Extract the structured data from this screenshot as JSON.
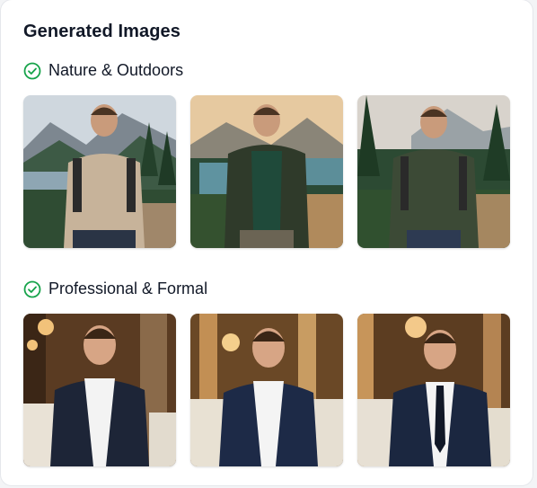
{
  "title": "Generated Images",
  "sections": [
    {
      "heading": "Nature & Outdoors",
      "icon": "check-circle-icon",
      "images": [
        {
          "scene": "lake-mountains",
          "top": "beige-tshirt"
        },
        {
          "scene": "lake-sunset",
          "top": "green-puffer-jacket"
        },
        {
          "scene": "forest-trail",
          "top": "olive-shirt"
        }
      ]
    },
    {
      "heading": "Professional & Formal",
      "icon": "check-circle-icon",
      "images": [
        {
          "scene": "restaurant",
          "top": "navy-suit-white-shirt"
        },
        {
          "scene": "restaurant",
          "top": "navy-suit-white-shirt"
        },
        {
          "scene": "restaurant",
          "top": "navy-suit-tie"
        }
      ]
    }
  ],
  "colors": {
    "accent": "#16a34a",
    "text": "#111827",
    "card": "#ffffff"
  }
}
